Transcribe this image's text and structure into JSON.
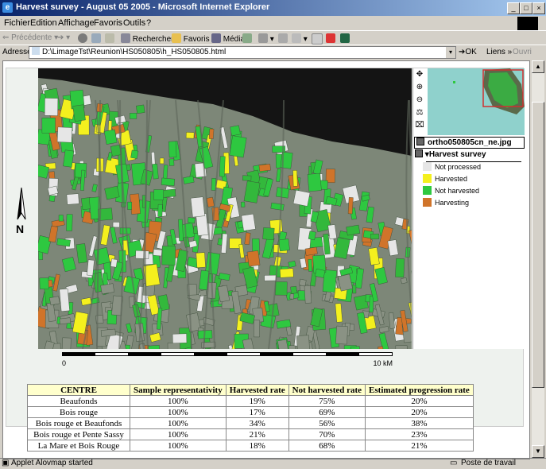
{
  "window": {
    "title": "Harvest survey - August 05 2005 - Microsoft Internet Explorer",
    "btn_min": "_",
    "btn_max": "□",
    "btn_close": "×"
  },
  "menu": [
    "Fichier",
    "Edition",
    "Affichage",
    "Favoris",
    "Outils",
    "?"
  ],
  "toolbar": {
    "back": "Précédente",
    "search": "Rechercher",
    "favorites": "Favoris",
    "media": "Média"
  },
  "address": {
    "label": "Adresse",
    "value": "D:\\LimageTst\\Reunion\\HS050805\\h_HS050805.html",
    "go": "OK",
    "links": "Liens",
    "extra": "Ouvri"
  },
  "map": {
    "layer_file": "ortho050805cn_ne.jpg",
    "layer_group": "Harvest survey",
    "legend": [
      {
        "label": "Not processed",
        "color": "#e6e6e6"
      },
      {
        "label": "Harvested",
        "color": "#f4f01e"
      },
      {
        "label": "Not harvested",
        "color": "#2ec840"
      },
      {
        "label": "Harvesting",
        "color": "#d0742a"
      }
    ],
    "north_label": "N",
    "scale_start": "0",
    "scale_end": "10 kM"
  },
  "table": {
    "headers": [
      "CENTRE",
      "Sample representativity",
      "Harvested rate",
      "Not harvested rate",
      "Estimated progression rate"
    ],
    "rows": [
      [
        "Beaufonds",
        "100%",
        "19%",
        "75%",
        "20%"
      ],
      [
        "Bois rouge",
        "100%",
        "17%",
        "69%",
        "20%"
      ],
      [
        "Bois rouge et Beaufonds",
        "100%",
        "34%",
        "56%",
        "38%"
      ],
      [
        "Bois rouge et Pente Sassy",
        "100%",
        "21%",
        "70%",
        "23%"
      ],
      [
        "La Mare et Bois Rouge",
        "100%",
        "18%",
        "68%",
        "21%"
      ]
    ]
  },
  "status": {
    "left": "Applet Alovmap started",
    "right": "Poste de travail"
  }
}
